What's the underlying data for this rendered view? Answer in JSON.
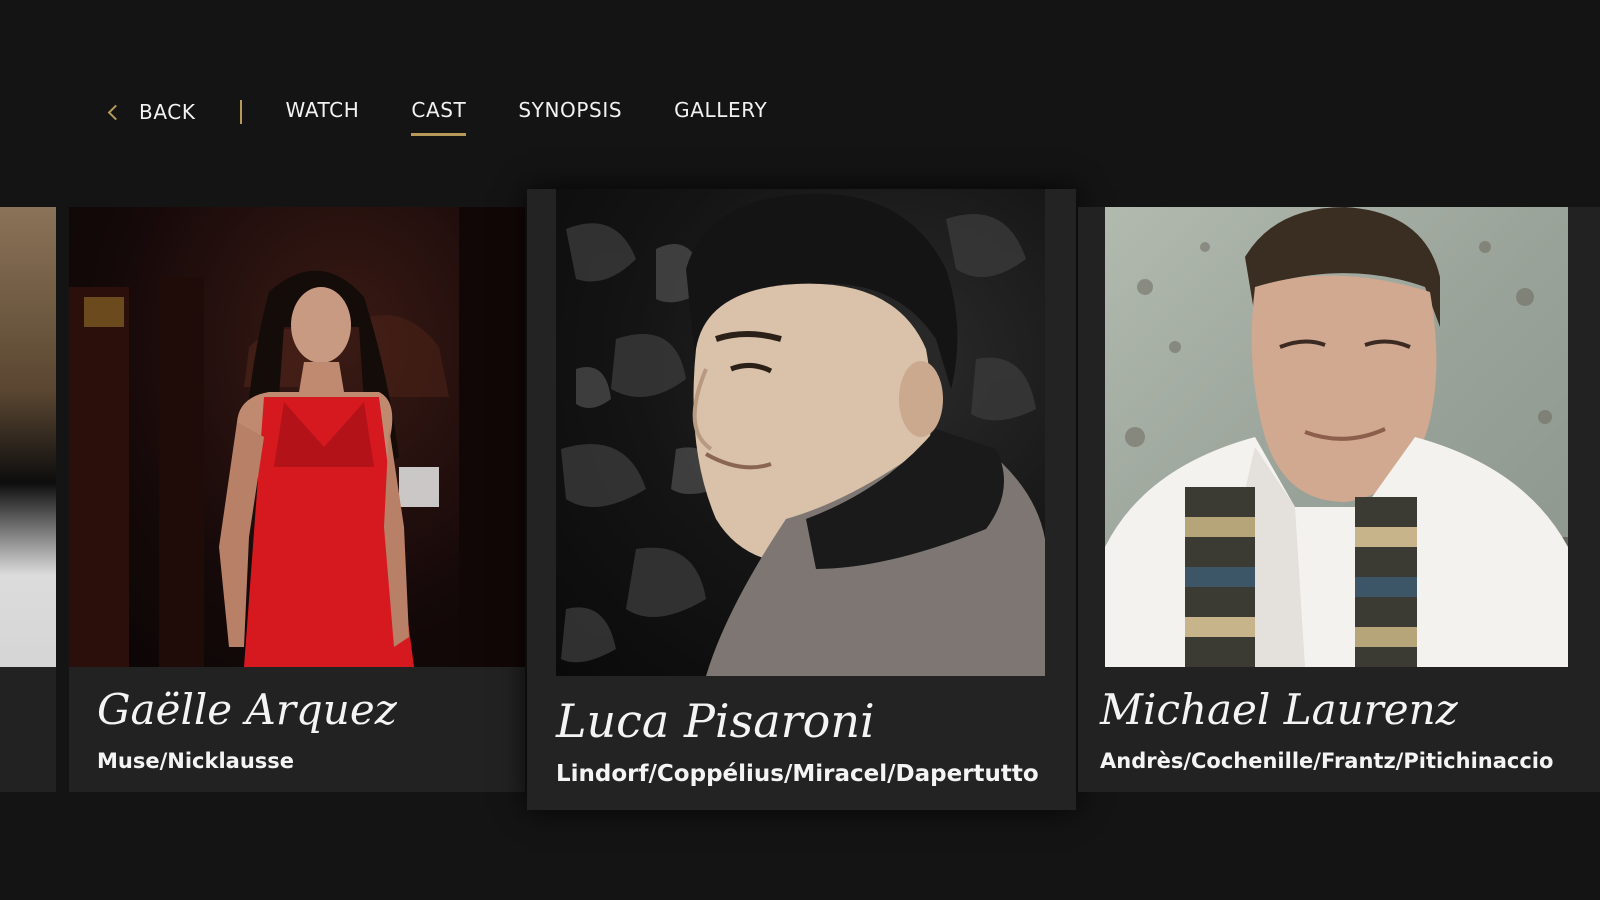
{
  "nav": {
    "back_label": "BACK",
    "tabs": [
      {
        "label": "WATCH"
      },
      {
        "label": "CAST"
      },
      {
        "label": "SYNOPSIS"
      },
      {
        "label": "GALLERY"
      }
    ],
    "active_tab": "CAST",
    "accent_color": "#b7995a"
  },
  "cast": [
    {
      "name": "Gaëlle  Arquez",
      "role": "Muse/Nicklausse"
    },
    {
      "name": "Luca Pisaroni",
      "role": "Lindorf/Coppélius/Miracel/Dapertutto"
    },
    {
      "name": "Michael Laurenz",
      "role": "Andrès/Cochenille/Frantz/Pitichinaccio"
    }
  ],
  "focused_index": 1
}
